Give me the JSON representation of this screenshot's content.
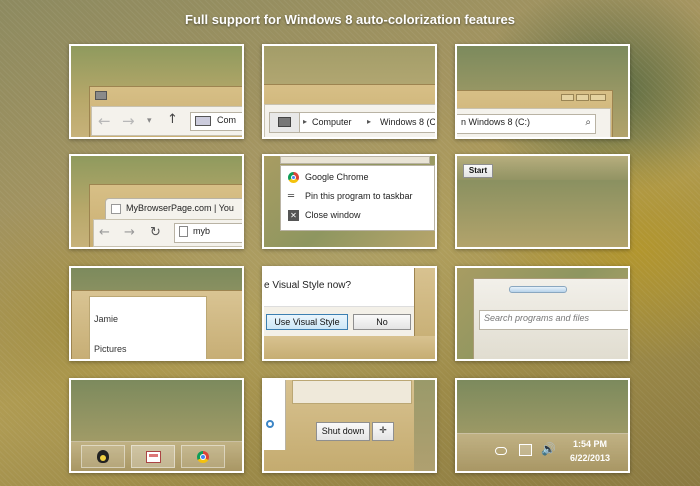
{
  "headline": "Full support for Windows 8 auto-colorization features",
  "explorer": {
    "nav_arrow_hint": "▾",
    "address_text": "Com",
    "crumbs": [
      "Computer",
      "Windows 8 (C:"
    ],
    "separator": "▸",
    "search_fragment": "n Windows 8 (C:)"
  },
  "browser": {
    "tab_title": "MyBrowserPage.com | You",
    "omnibox_text": "myb"
  },
  "jumplist": {
    "items": [
      "Google Chrome",
      "Pin this program to taskbar",
      "Close window"
    ]
  },
  "start_button": "Start",
  "start_menu": {
    "user_name": "Jamie",
    "pictures": "Pictures",
    "search_placeholder": "Search programs and files"
  },
  "dialog": {
    "question": "e Visual Style now?",
    "use_button": "Use Visual Style",
    "no_button": "No"
  },
  "shutdown": {
    "button_label": "Shut down"
  },
  "tray": {
    "time": "1:54 PM",
    "date": "6/22/2013"
  },
  "colors": {
    "accent_frame": "#d7bf86",
    "tile_border": "#ffffff",
    "headline": "#ffffff"
  }
}
